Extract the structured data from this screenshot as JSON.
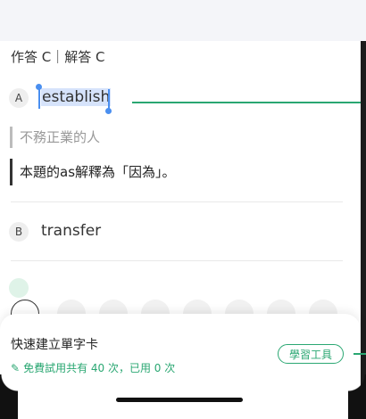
{
  "header": {
    "label": "作答 C｜解答 C"
  },
  "options": [
    {
      "letter": "A",
      "text": "establish"
    },
    {
      "letter": "B",
      "text": "transfer"
    }
  ],
  "notes": {
    "grey": "不務正業的人",
    "dark": "本題的as解釋為「因為」。"
  },
  "sheet": {
    "title": "快速建立單字卡",
    "subtitle": "免費試用共有 40 次，已用 0 次",
    "tool_button": "學習工具",
    "wand_icon": "wand-icon"
  },
  "colors": {
    "accent": "#2aa772",
    "selection": "#4a8ff0",
    "highlight": "#d6e3fb"
  }
}
